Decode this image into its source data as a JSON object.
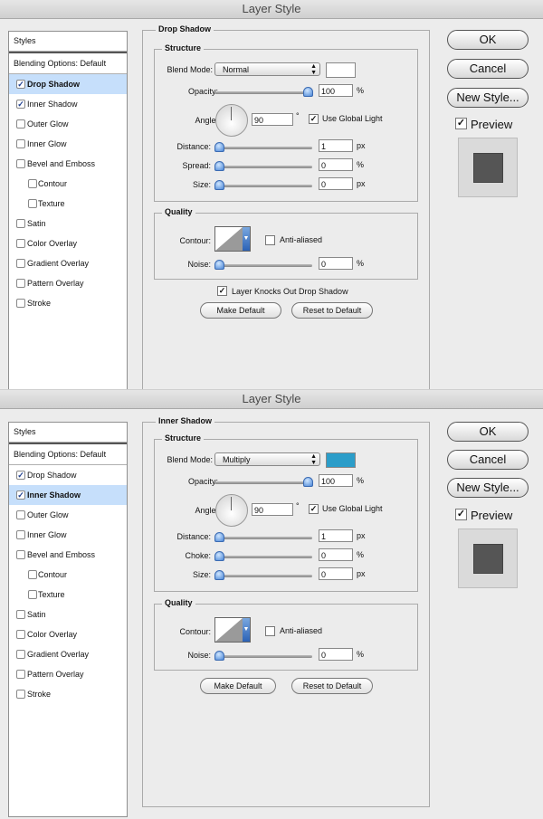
{
  "dialogs": [
    {
      "title": "Layer Style",
      "panel_title": "Drop Shadow",
      "style_list": {
        "header": "Styles",
        "blending": "Blending Options: Default",
        "items": [
          {
            "label": "Drop Shadow",
            "checked": true,
            "selected": true,
            "indent": false
          },
          {
            "label": "Inner Shadow",
            "checked": true,
            "selected": false,
            "indent": false
          },
          {
            "label": "Outer Glow",
            "checked": false,
            "selected": false,
            "indent": false
          },
          {
            "label": "Inner Glow",
            "checked": false,
            "selected": false,
            "indent": false
          },
          {
            "label": "Bevel and Emboss",
            "checked": false,
            "selected": false,
            "indent": false
          },
          {
            "label": "Contour",
            "checked": false,
            "selected": false,
            "indent": true
          },
          {
            "label": "Texture",
            "checked": false,
            "selected": false,
            "indent": true
          },
          {
            "label": "Satin",
            "checked": false,
            "selected": false,
            "indent": false
          },
          {
            "label": "Color Overlay",
            "checked": false,
            "selected": false,
            "indent": false
          },
          {
            "label": "Gradient Overlay",
            "checked": false,
            "selected": false,
            "indent": false
          },
          {
            "label": "Pattern Overlay",
            "checked": false,
            "selected": false,
            "indent": false
          },
          {
            "label": "Stroke",
            "checked": false,
            "selected": false,
            "indent": false
          }
        ]
      },
      "structure": {
        "title": "Structure",
        "blend_mode_label": "Blend Mode:",
        "blend_mode": "Normal",
        "swatch_color": "#ffffff",
        "opacity_label": "Opacity:",
        "opacity": "100",
        "opacity_unit": "%",
        "angle_label": "Angle:",
        "angle": "90",
        "angle_unit": "°",
        "use_global_light": "Use Global Light",
        "use_global_light_checked": true,
        "distance_label": "Distance:",
        "distance": "1",
        "distance_unit": "px",
        "third_label": "Spread:",
        "third_value": "0",
        "third_unit": "%",
        "size_label": "Size:",
        "size": "0",
        "size_unit": "px",
        "slider_levels": {
          "opacity": 1.0,
          "distance": 0.0,
          "third": 0.0,
          "size": 0.0
        }
      },
      "quality": {
        "title": "Quality",
        "contour_label": "Contour:",
        "anti_aliased": "Anti-aliased",
        "anti_aliased_checked": false,
        "noise_label": "Noise:",
        "noise": "0",
        "noise_unit": "%",
        "noise_level": 0.0
      },
      "knock_out": "Layer Knocks Out Drop Shadow",
      "knock_out_checked": true,
      "make_default": "Make Default",
      "reset_default": "Reset to Default",
      "buttons": {
        "ok": "OK",
        "cancel": "Cancel",
        "new_style": "New Style..."
      },
      "preview": "Preview",
      "preview_checked": true
    },
    {
      "title": "Layer Style",
      "panel_title": "Inner Shadow",
      "style_list": {
        "header": "Styles",
        "blending": "Blending Options: Default",
        "items": [
          {
            "label": "Drop Shadow",
            "checked": true,
            "selected": false,
            "indent": false
          },
          {
            "label": "Inner Shadow",
            "checked": true,
            "selected": true,
            "indent": false
          },
          {
            "label": "Outer Glow",
            "checked": false,
            "selected": false,
            "indent": false
          },
          {
            "label": "Inner Glow",
            "checked": false,
            "selected": false,
            "indent": false
          },
          {
            "label": "Bevel and Emboss",
            "checked": false,
            "selected": false,
            "indent": false
          },
          {
            "label": "Contour",
            "checked": false,
            "selected": false,
            "indent": true
          },
          {
            "label": "Texture",
            "checked": false,
            "selected": false,
            "indent": true
          },
          {
            "label": "Satin",
            "checked": false,
            "selected": false,
            "indent": false
          },
          {
            "label": "Color Overlay",
            "checked": false,
            "selected": false,
            "indent": false
          },
          {
            "label": "Gradient Overlay",
            "checked": false,
            "selected": false,
            "indent": false
          },
          {
            "label": "Pattern Overlay",
            "checked": false,
            "selected": false,
            "indent": false
          },
          {
            "label": "Stroke",
            "checked": false,
            "selected": false,
            "indent": false
          }
        ]
      },
      "structure": {
        "title": "Structure",
        "blend_mode_label": "Blend Mode:",
        "blend_mode": "Multiply",
        "swatch_color": "#2b9dc9",
        "opacity_label": "Opacity:",
        "opacity": "100",
        "opacity_unit": "%",
        "angle_label": "Angle:",
        "angle": "90",
        "angle_unit": "°",
        "use_global_light": "Use Global Light",
        "use_global_light_checked": true,
        "distance_label": "Distance:",
        "distance": "1",
        "distance_unit": "px",
        "third_label": "Choke:",
        "third_value": "0",
        "third_unit": "%",
        "size_label": "Size:",
        "size": "0",
        "size_unit": "px",
        "slider_levels": {
          "opacity": 1.0,
          "distance": 0.0,
          "third": 0.0,
          "size": 0.0
        }
      },
      "quality": {
        "title": "Quality",
        "contour_label": "Contour:",
        "anti_aliased": "Anti-aliased",
        "anti_aliased_checked": false,
        "noise_label": "Noise:",
        "noise": "0",
        "noise_unit": "%",
        "noise_level": 0.0
      },
      "knock_out": "",
      "knock_out_checked": false,
      "make_default": "Make Default",
      "reset_default": "Reset to Default",
      "buttons": {
        "ok": "OK",
        "cancel": "Cancel",
        "new_style": "New Style..."
      },
      "preview": "Preview",
      "preview_checked": true
    }
  ]
}
